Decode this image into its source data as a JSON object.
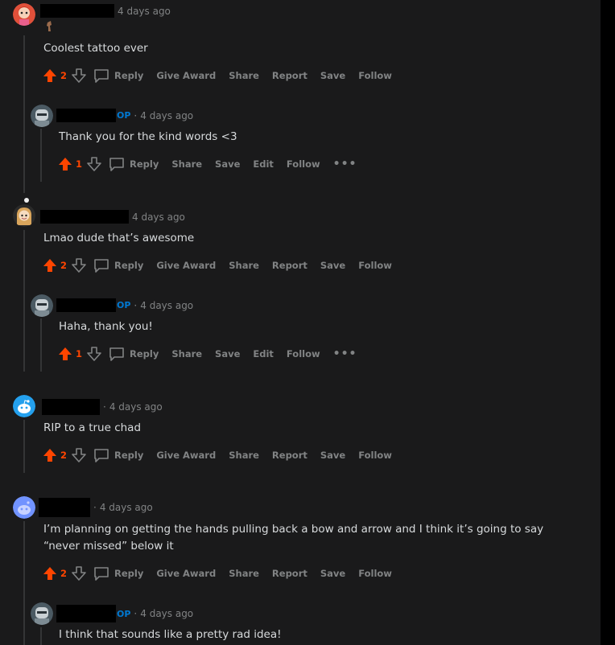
{
  "comments": [
    {
      "time": "4 days ago",
      "is_op": false,
      "body": "Coolest tattoo ever",
      "votes": "2",
      "actions": [
        "Reply",
        "Give Award",
        "Share",
        "Report",
        "Save",
        "Follow"
      ],
      "avatar_color": "#e0503a"
    },
    {
      "time": "4 days ago",
      "is_op": true,
      "op_label": "OP",
      "body": "Thank you for the kind words <3",
      "votes": "1",
      "actions": [
        "Reply",
        "Share",
        "Save",
        "Edit",
        "Follow"
      ],
      "avatar_color": "#6a7a86"
    },
    {
      "time": "4 days ago",
      "is_op": false,
      "body": "Lmao dude that’s awesome",
      "votes": "2",
      "actions": [
        "Reply",
        "Give Award",
        "Share",
        "Report",
        "Save",
        "Follow"
      ],
      "avatar_color": "#d9a55c"
    },
    {
      "time": "4 days ago",
      "is_op": true,
      "op_label": "OP",
      "body": "Haha, thank you!",
      "votes": "1",
      "actions": [
        "Reply",
        "Share",
        "Save",
        "Edit",
        "Follow"
      ],
      "avatar_color": "#6a7a86"
    },
    {
      "time": "4 days ago",
      "is_op": false,
      "body": "RIP to a true chad",
      "votes": "2",
      "actions": [
        "Reply",
        "Give Award",
        "Share",
        "Report",
        "Save",
        "Follow"
      ],
      "avatar_color": "#24a0ed"
    },
    {
      "time": "4 days ago",
      "is_op": false,
      "body_line1": "I’m planning on getting the hands pulling back a bow and arrow and I think it’s going to say",
      "body_line2": "“never missed” below it",
      "votes": "2",
      "actions": [
        "Reply",
        "Give Award",
        "Share",
        "Report",
        "Save",
        "Follow"
      ],
      "avatar_color": "#7193ff"
    },
    {
      "time": "4 days ago",
      "is_op": true,
      "op_label": "OP",
      "body": "I think that sounds like a pretty rad idea!",
      "avatar_color": "#6a7a86"
    }
  ],
  "colors": {
    "background": "#1a1a1b",
    "upvote": "#ff4500",
    "op": "#0079d3",
    "muted": "#818384",
    "text": "#d7dadc"
  }
}
